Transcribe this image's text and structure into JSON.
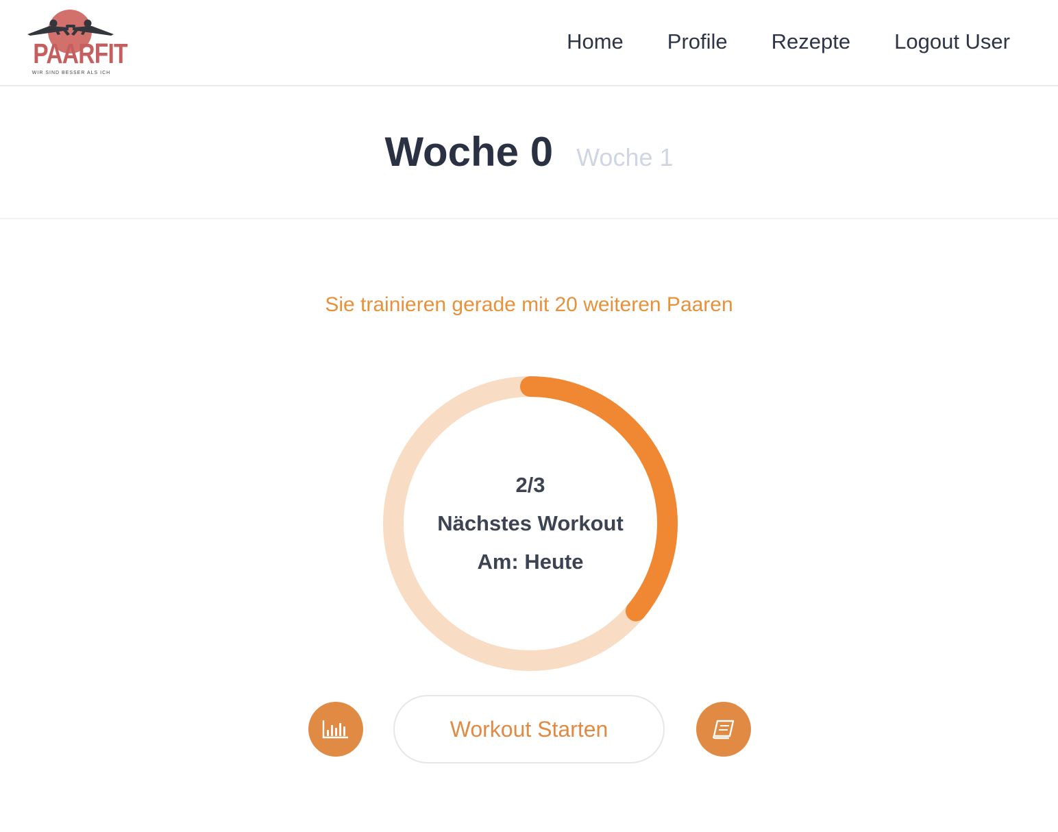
{
  "brand": {
    "name": "PAARFIT",
    "tagline": "WIR SIND BESSER ALS ICH",
    "color": "#c55f5f"
  },
  "nav": {
    "items": [
      {
        "label": "Home"
      },
      {
        "label": "Profile"
      },
      {
        "label": "Rezepte"
      },
      {
        "label": "Logout User"
      }
    ]
  },
  "weeks": {
    "current": "Woche 0",
    "next": "Woche 1"
  },
  "main": {
    "train_note": "Sie trainieren gerade mit 20 weiteren Paaren",
    "progress": {
      "label": "2/3",
      "completed": 2,
      "total": 3,
      "fraction_shown": 0.36,
      "next_workout": "Nächstes Workout",
      "when": "Am: Heute"
    },
    "start_button": "Workout Starten",
    "left_icon": "bar-chart-icon",
    "right_icon": "book-icon"
  },
  "colors": {
    "accent": "#e08a43",
    "ring_track": "#f9dcc4",
    "ring_fill": "#f08733",
    "text_dark": "#2d3446",
    "week_muted": "#cfd6e2"
  }
}
